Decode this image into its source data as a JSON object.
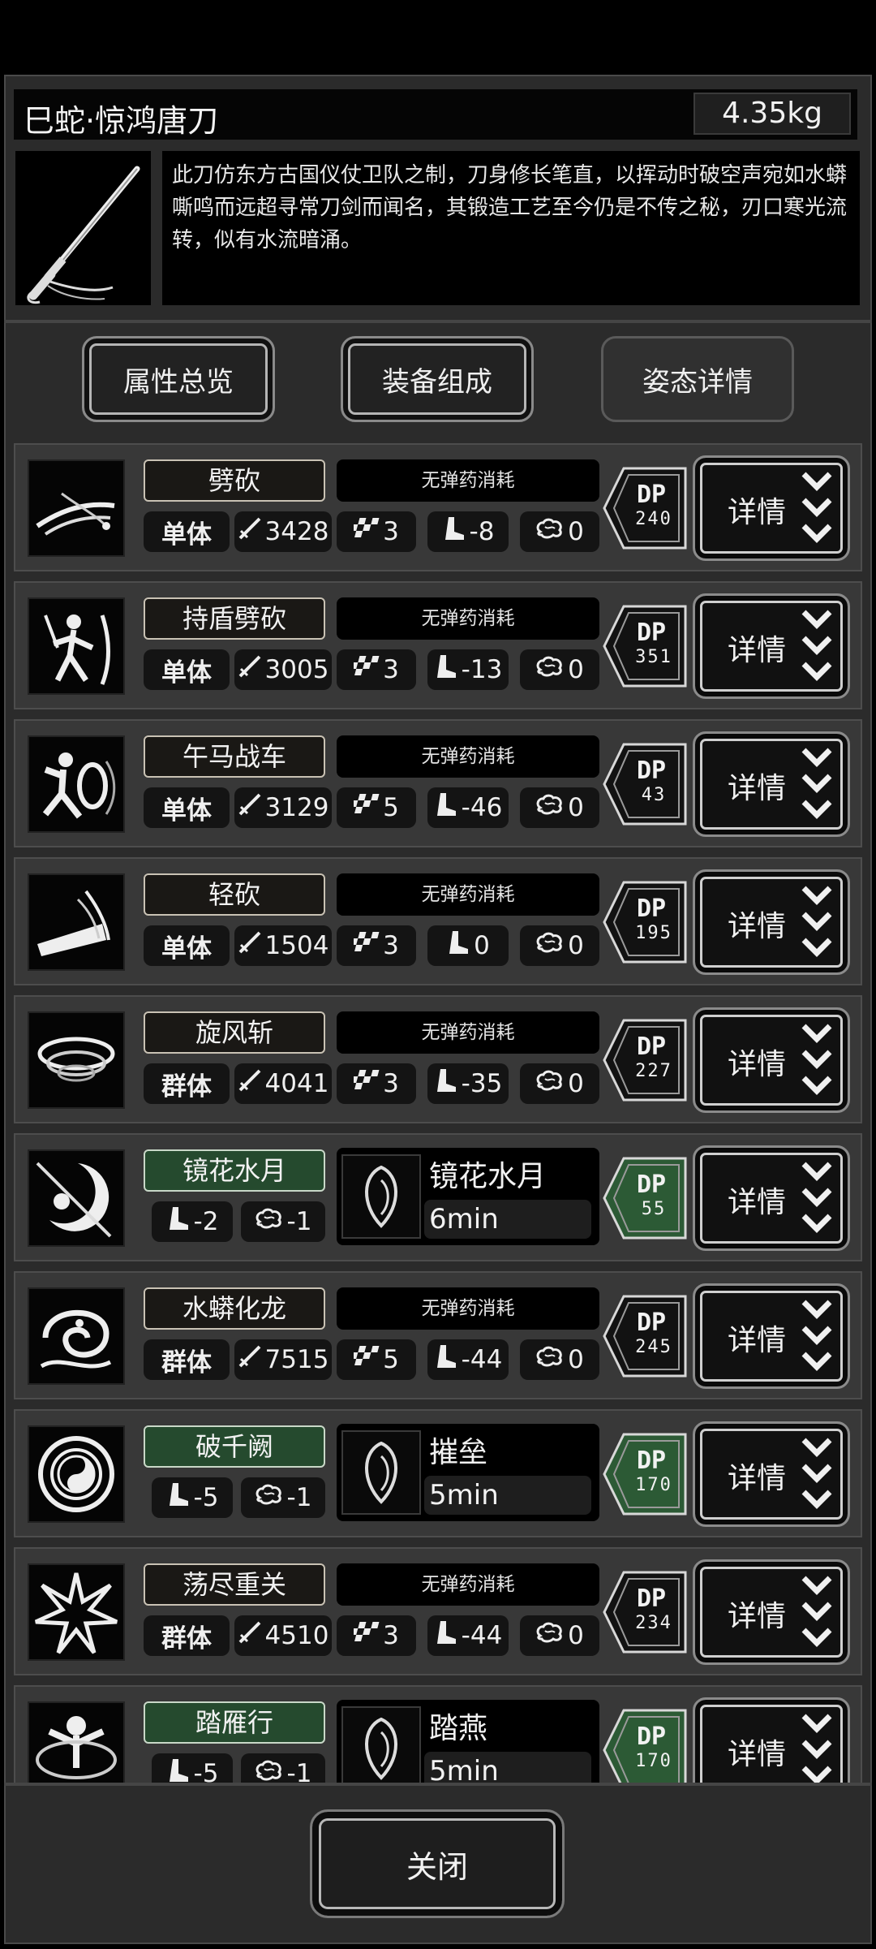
{
  "weapon": {
    "title": "巳蛇·惊鸿唐刀",
    "weight": "4.35kg",
    "description": "此刀仿东方古国仪仗卫队之制，刀身修长笔直，以挥动时破空声宛如水蟒嘶鸣而远超寻常刀剑而闻名，其锻造工艺至今仍是不传之秘，刃口寒光流转，似有水流暗涌。"
  },
  "tabs": [
    {
      "label": "属性总览"
    },
    {
      "label": "装备组成"
    },
    {
      "label": "姿态详情",
      "active": true
    }
  ],
  "colors": {
    "panel": "#2b2b2b",
    "row": "#383838",
    "name_green": "#254a2e",
    "dp_green": "#2c5a35",
    "dp_dark": "#121212"
  },
  "skills": [
    {
      "name": "劈砍",
      "ammo": "无弹药消耗",
      "target": "单体",
      "attack": "3428",
      "hits": "3",
      "stamina": "-8",
      "brain": "0",
      "dp": "240",
      "detail": "详情",
      "icon": "slash-icon"
    },
    {
      "name": "持盾劈砍",
      "ammo": "无弹药消耗",
      "target": "单体",
      "attack": "3005",
      "hits": "3",
      "stamina": "-13",
      "brain": "0",
      "dp": "351",
      "detail": "详情",
      "icon": "swordsman-icon"
    },
    {
      "name": "午马战车",
      "ammo": "无弹药消耗",
      "target": "单体",
      "attack": "3129",
      "hits": "5",
      "stamina": "-46",
      "brain": "0",
      "dp": "43",
      "detail": "详情",
      "icon": "shield-charge-icon"
    },
    {
      "name": "轻砍",
      "ammo": "无弹药消耗",
      "target": "单体",
      "attack": "1504",
      "hits": "3",
      "stamina": "0",
      "brain": "0",
      "dp": "195",
      "detail": "详情",
      "icon": "light-slash-icon"
    },
    {
      "name": "旋风斩",
      "ammo": "无弹药消耗",
      "target": "群体",
      "attack": "4041",
      "hits": "3",
      "stamina": "-35",
      "brain": "0",
      "dp": "227",
      "detail": "详情",
      "icon": "whirlwind-icon"
    },
    {
      "name": "镜花水月",
      "buff": true,
      "stamina": "-2",
      "brain": "-1",
      "buff_name": "镜花水月",
      "buff_time": "6min",
      "dp": "55",
      "detail": "详情",
      "icon": "moon-flower-icon"
    },
    {
      "name": "水蟒化龙",
      "ammo": "无弹药消耗",
      "target": "群体",
      "attack": "7515",
      "hits": "5",
      "stamina": "-44",
      "brain": "0",
      "dp": "245",
      "detail": "详情",
      "icon": "water-dragon-icon"
    },
    {
      "name": "破千阙",
      "buff": true,
      "stamina": "-5",
      "brain": "-1",
      "buff_name": "摧垒",
      "buff_time": "5min",
      "dp": "170",
      "detail": "详情",
      "icon": "yin-yang-icon"
    },
    {
      "name": "荡尽重关",
      "ammo": "无弹药消耗",
      "target": "群体",
      "attack": "4510",
      "hits": "3",
      "stamina": "-44",
      "brain": "0",
      "dp": "234",
      "detail": "详情",
      "icon": "burst-icon"
    },
    {
      "name": "踏雁行",
      "buff": true,
      "stamina": "-5",
      "brain": "-1",
      "buff_name": "踏燕",
      "buff_time": "5min",
      "dp": "170",
      "detail": "详情",
      "icon": "martial-figure-icon"
    }
  ],
  "close_label": "关闭"
}
